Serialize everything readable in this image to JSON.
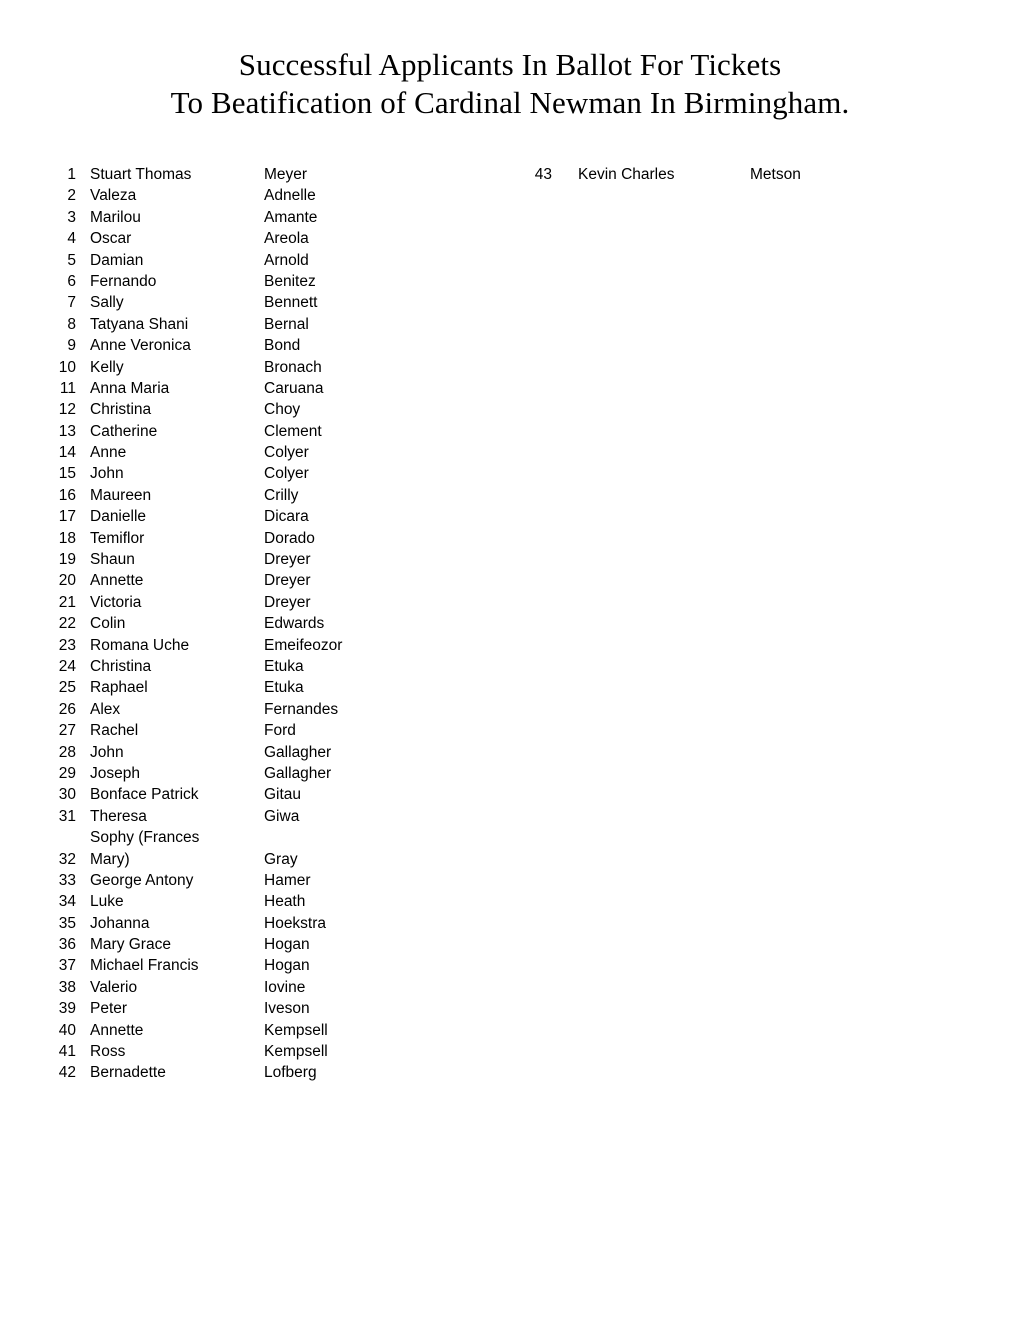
{
  "document": {
    "title_lines": [
      "Successful Applicants In Ballot For Tickets",
      "To Beatification of Cardinal Newman In Birmingham."
    ],
    "background_color": "#ffffff",
    "text_color": "#000000"
  },
  "list": {
    "columns": [
      {
        "name": "left-column",
        "entries": [
          {
            "number": "1",
            "given_name": "Stuart Thomas",
            "surname": "Meyer"
          },
          {
            "number": "2",
            "given_name": "Valeza",
            "surname": "Adnelle"
          },
          {
            "number": "3",
            "given_name": "Marilou",
            "surname": "Amante"
          },
          {
            "number": "4",
            "given_name": "Oscar",
            "surname": "Areola"
          },
          {
            "number": "5",
            "given_name": "Damian",
            "surname": "Arnold"
          },
          {
            "number": "6",
            "given_name": "Fernando",
            "surname": "Benitez"
          },
          {
            "number": "7",
            "given_name": "Sally",
            "surname": "Bennett"
          },
          {
            "number": "8",
            "given_name": "Tatyana Shani",
            "surname": "Bernal"
          },
          {
            "number": "9",
            "given_name": "Anne Veronica",
            "surname": "Bond"
          },
          {
            "number": "10",
            "given_name": "Kelly",
            "surname": "Bronach"
          },
          {
            "number": "11",
            "given_name": "Anna Maria",
            "surname": "Caruana"
          },
          {
            "number": "12",
            "given_name": "Christina",
            "surname": "Choy"
          },
          {
            "number": "13",
            "given_name": "Catherine",
            "surname": "Clement"
          },
          {
            "number": "14",
            "given_name": "Anne",
            "surname": "Colyer"
          },
          {
            "number": "15",
            "given_name": "John",
            "surname": "Colyer"
          },
          {
            "number": "16",
            "given_name": "Maureen",
            "surname": "Crilly"
          },
          {
            "number": "17",
            "given_name": "Danielle",
            "surname": "Dicara"
          },
          {
            "number": "18",
            "given_name": "Temiflor",
            "surname": "Dorado"
          },
          {
            "number": "19",
            "given_name": "Shaun",
            "surname": "Dreyer"
          },
          {
            "number": "20",
            "given_name": "Annette",
            "surname": "Dreyer"
          },
          {
            "number": "21",
            "given_name": "Victoria",
            "surname": "Dreyer"
          },
          {
            "number": "22",
            "given_name": "Colin",
            "surname": "Edwards"
          },
          {
            "number": "23",
            "given_name": "Romana Uche",
            "surname": "Emeifeozor"
          },
          {
            "number": "24",
            "given_name": "Christina",
            "surname": "Etuka"
          },
          {
            "number": "25",
            "given_name": "Raphael",
            "surname": "Etuka"
          },
          {
            "number": "26",
            "given_name": "Alex",
            "surname": "Fernandes"
          },
          {
            "number": "27",
            "given_name": "Rachel",
            "surname": "Ford"
          },
          {
            "number": "28",
            "given_name": "John",
            "surname": "Gallagher"
          },
          {
            "number": "29",
            "given_name": "Joseph",
            "surname": "Gallagher"
          },
          {
            "number": "30",
            "given_name": "Bonface Patrick",
            "surname": "Gitau"
          },
          {
            "number": "31",
            "given_name": "Theresa",
            "surname": "Giwa"
          },
          {
            "number": "32",
            "given_name": "Sophy (Frances\nMary)",
            "surname": "Gray",
            "wrapped": true
          },
          {
            "number": "33",
            "given_name": "George Antony",
            "surname": "Hamer"
          },
          {
            "number": "34",
            "given_name": "Luke",
            "surname": "Heath"
          },
          {
            "number": "35",
            "given_name": "Johanna",
            "surname": "Hoekstra"
          },
          {
            "number": "36",
            "given_name": "Mary Grace",
            "surname": "Hogan"
          },
          {
            "number": "37",
            "given_name": "Michael Francis",
            "surname": "Hogan"
          },
          {
            "number": "38",
            "given_name": "Valerio",
            "surname": "Iovine"
          },
          {
            "number": "39",
            "given_name": "Peter",
            "surname": "Iveson"
          },
          {
            "number": "40",
            "given_name": "Annette",
            "surname": "Kempsell"
          },
          {
            "number": "41",
            "given_name": "Ross",
            "surname": "Kempsell"
          },
          {
            "number": "42",
            "given_name": "Bernadette",
            "surname": "Lofberg"
          }
        ]
      },
      {
        "name": "right-column",
        "entries": [
          {
            "number": "43",
            "given_name": "Kevin Charles",
            "surname": "Metson"
          }
        ]
      }
    ]
  }
}
